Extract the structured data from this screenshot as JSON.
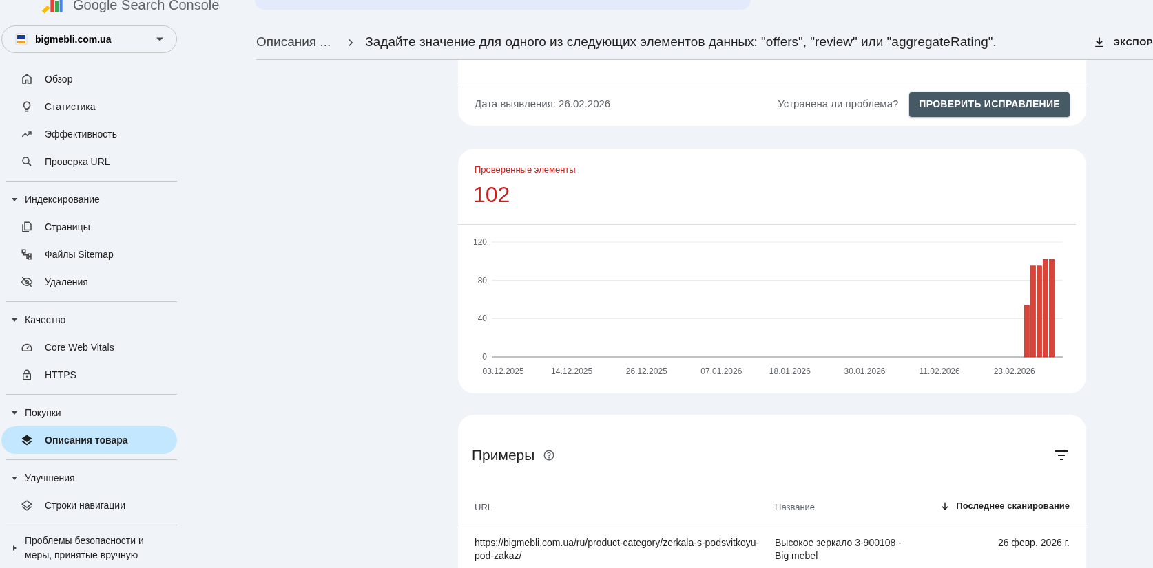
{
  "app": {
    "title": "Google Search Console"
  },
  "property": {
    "name": "bigmebli.com.ua"
  },
  "nav": {
    "top": [
      {
        "label": "Обзор",
        "selected": false
      },
      {
        "label": "Статистика",
        "selected": false
      },
      {
        "label": "Эффективность",
        "selected": false
      },
      {
        "label": "Проверка URL",
        "selected": false
      }
    ],
    "sections": [
      {
        "title": "Индексирование",
        "expanded": true,
        "items": [
          {
            "label": "Страницы",
            "selected": false
          },
          {
            "label": "Файлы Sitemap",
            "selected": false
          },
          {
            "label": "Удаления",
            "selected": false
          }
        ]
      },
      {
        "title": "Качество",
        "expanded": true,
        "items": [
          {
            "label": "Core Web Vitals",
            "selected": false
          },
          {
            "label": "HTTPS",
            "selected": false
          }
        ]
      },
      {
        "title": "Покупки",
        "expanded": true,
        "items": [
          {
            "label": "Описания товара",
            "selected": true
          }
        ]
      },
      {
        "title": "Улучшения",
        "expanded": true,
        "items": [
          {
            "label": "Строки навигации",
            "selected": false
          }
        ]
      },
      {
        "title": "Проблемы безопасности и меры, принятые вручную",
        "expanded": false
      }
    ]
  },
  "breadcrumb": [
    "Описания ...",
    "Задайте значение для одного из следующих элементов данных: \"offers\", \"review\" или \"aggregateRating\"."
  ],
  "export": "ЭКСПОР",
  "issue": {
    "detected": "Дата выявления: 26.02.2026",
    "question": "Устранена ли проблема?",
    "button": "ПРОВЕРИТЬ ИСПРАВЛЕНИЕ"
  },
  "metric": {
    "label": "Проверенные элементы",
    "value": "102",
    "chart_data": {
      "type": "bar",
      "categories": [
        "03.12.2025",
        null,
        null,
        null,
        null,
        null,
        null,
        null,
        null,
        null,
        null,
        "14.12.2025",
        null,
        null,
        null,
        null,
        null,
        null,
        null,
        null,
        null,
        null,
        null,
        "26.12.2025",
        null,
        null,
        null,
        null,
        null,
        null,
        null,
        null,
        null,
        null,
        null,
        "07.01.2026",
        null,
        null,
        null,
        null,
        null,
        null,
        null,
        null,
        null,
        null,
        "18.01.2026",
        null,
        null,
        null,
        null,
        null,
        null,
        null,
        null,
        null,
        null,
        null,
        "30.01.2026",
        null,
        null,
        null,
        null,
        null,
        null,
        null,
        null,
        null,
        null,
        null,
        "11.02.2026",
        null,
        null,
        null,
        null,
        null,
        null,
        null,
        null,
        null,
        null,
        null,
        "23.02.2026",
        null,
        null,
        null,
        null,
        null,
        null
      ],
      "values": [
        null,
        null,
        null,
        null,
        null,
        null,
        null,
        null,
        null,
        null,
        null,
        null,
        null,
        null,
        null,
        null,
        null,
        null,
        null,
        null,
        null,
        null,
        null,
        null,
        null,
        null,
        null,
        null,
        null,
        null,
        null,
        null,
        null,
        null,
        null,
        null,
        null,
        null,
        null,
        null,
        null,
        null,
        null,
        null,
        null,
        null,
        null,
        null,
        null,
        null,
        null,
        null,
        null,
        null,
        null,
        null,
        null,
        null,
        null,
        null,
        null,
        null,
        null,
        null,
        null,
        null,
        null,
        null,
        null,
        null,
        null,
        null,
        null,
        null,
        null,
        null,
        null,
        null,
        null,
        null,
        null,
        null,
        null,
        null,
        54,
        95,
        95,
        102,
        102
      ],
      "ylim": [
        0,
        120
      ],
      "yticks": [
        0,
        40,
        80,
        120
      ]
    }
  },
  "examples": {
    "title": "Примеры",
    "columns": [
      {
        "label": "URL",
        "sorted": false
      },
      {
        "label": "Название",
        "sorted": false
      },
      {
        "label": "Последнее сканирование",
        "sorted": true
      }
    ],
    "rows": [
      {
        "url": "https://bigmebli.com.ua/ru/product-category/zerkala-s-podsvitkoyu-pod-zakaz/",
        "name": "Высокое зеркало 3-900108 - Big mebel",
        "last_crawl": "26 февр. 2026 г."
      }
    ]
  }
}
